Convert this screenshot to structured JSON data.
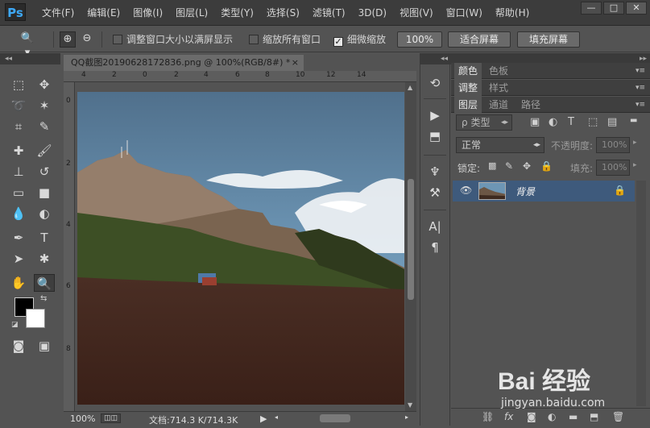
{
  "menubar": {
    "logo": "Ps",
    "items": [
      "文件(F)",
      "编辑(E)",
      "图像(I)",
      "图层(L)",
      "类型(Y)",
      "选择(S)",
      "滤镜(T)",
      "3D(D)",
      "视图(V)",
      "窗口(W)",
      "帮助(H)"
    ],
    "window_controls": [
      "—",
      "□",
      "✕"
    ]
  },
  "options": {
    "resize_windows": "调整窗口大小以满屏显示",
    "zoom_all_windows": "缩放所有窗口",
    "scrubby_zoom": "细微缩放",
    "zoom_100": "100%",
    "fit_screen": "适合屏幕",
    "fill_screen": "填充屏幕",
    "scrubby_checked": true
  },
  "document": {
    "tab_title": "QQ截图20190628172836.png @ 100%(RGB/8#) *",
    "ruler_top": [
      "4",
      "2",
      "0",
      "2",
      "4",
      "6",
      "8",
      "10",
      "12",
      "14"
    ],
    "ruler_left": [
      "0",
      "2",
      "4",
      "6",
      "8"
    ]
  },
  "status": {
    "zoom": "100%",
    "doc_size": "文档:714.3 K/714.3K"
  },
  "panels": {
    "row1": [
      "颜色",
      "色板"
    ],
    "row2": [
      "调整",
      "样式"
    ],
    "row3": [
      "图层",
      "通道",
      "路径"
    ],
    "filter_kind": "类型",
    "blend_mode": "正常",
    "opacity_label": "不透明度:",
    "opacity_value": "100%",
    "lock_label": "锁定:",
    "fill_label": "填充:",
    "fill_value": "100%",
    "layer_name": "背景"
  },
  "watermark": {
    "main": "Bai 经验",
    "sub": "jingyan.baidu.com"
  }
}
